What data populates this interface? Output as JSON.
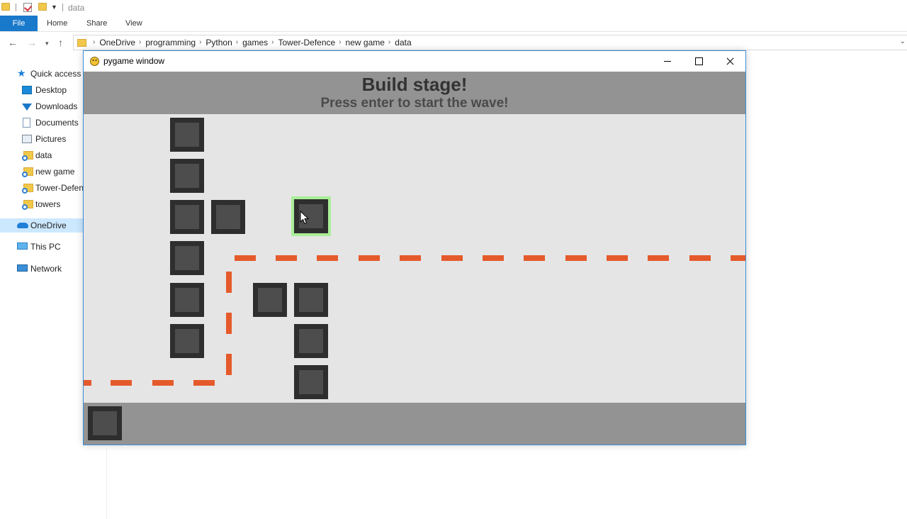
{
  "explorer": {
    "window_title": "data",
    "ribbon_tabs": [
      "File",
      "Home",
      "Share",
      "View"
    ],
    "breadcrumb": [
      "OneDrive",
      "programming",
      "Python",
      "games",
      "Tower-Defence",
      "new game",
      "data"
    ],
    "nav_pane": [
      {
        "label": "Quick access",
        "icon": "star-icon"
      },
      {
        "label": "Desktop",
        "icon": "desktop-icon"
      },
      {
        "label": "Downloads",
        "icon": "download-icon"
      },
      {
        "label": "Documents",
        "icon": "documents-icon"
      },
      {
        "label": "Pictures",
        "icon": "pictures-icon"
      },
      {
        "label": "data",
        "icon": "folder-icon"
      },
      {
        "label": "new game",
        "icon": "folder-icon"
      },
      {
        "label": "Tower-Defence",
        "icon": "folder-icon"
      },
      {
        "label": "towers",
        "icon": "folder-icon"
      },
      {
        "label": "OneDrive",
        "icon": "onedrive-icon"
      },
      {
        "label": "This PC",
        "icon": "pc-icon"
      },
      {
        "label": "Network",
        "icon": "network-icon"
      }
    ]
  },
  "pygame": {
    "window_title": "pygame window",
    "header_title": "Build stage!",
    "header_subtitle": "Press enter to start the wave!",
    "colors": {
      "header_bg": "#939393",
      "field_bg": "#e5e5e5",
      "tower_border": "#2e2e2e",
      "tower_fill": "#4d4d4d",
      "path_dash": "#e55a2b",
      "placement_highlight": "#a9ee99"
    }
  }
}
